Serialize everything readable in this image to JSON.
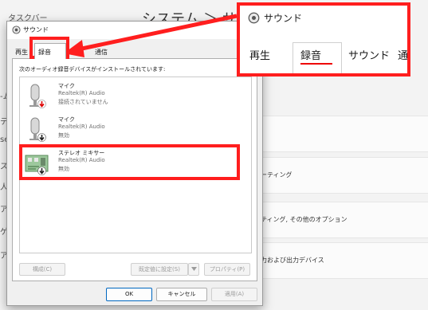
{
  "background": {
    "app_name": "タスクバー",
    "title": "システム ＞ サウ",
    "side_chars": [
      "-ム",
      "テ",
      "se",
      "ス",
      "人",
      "ア",
      "ゲ",
      "ア"
    ],
    "rows": [
      {
        "label": ""
      },
      {
        "label": "ーティング"
      },
      {
        "label": "ティング, その他のオプション"
      },
      {
        "label": "力および出力デバイス"
      }
    ]
  },
  "dialog": {
    "title": "サウンド",
    "tabs": [
      {
        "label": "再生",
        "active": false
      },
      {
        "label": "録音",
        "active": true
      },
      {
        "label": "通信",
        "active": false
      }
    ],
    "instruction": "次のオーディオ録音デバイスがインストールされています:",
    "devices": [
      {
        "name": "マイク",
        "driver": "Realtek(R) Audio",
        "status": "接続されていません",
        "type": "mic",
        "badge": "red"
      },
      {
        "name": "マイク",
        "driver": "Realtek(R) Audio",
        "status": "無効",
        "type": "mic",
        "badge": "dark"
      },
      {
        "name": "ステレオ ミキサー",
        "driver": "Realtek(R) Audio",
        "status": "無効",
        "type": "board",
        "badge": "dark"
      }
    ],
    "buttons": {
      "configure": "構成(C)",
      "set_default": "既定値に設定(S)",
      "properties": "プロパティ(P)",
      "ok": "OK",
      "cancel": "キャンセル",
      "apply": "適用(A)"
    }
  },
  "callout": {
    "title": "サウンド",
    "tabs": [
      {
        "label": "再生"
      },
      {
        "label": "録音"
      },
      {
        "label": "サウンド"
      },
      {
        "label": "通"
      }
    ]
  },
  "colors": {
    "annotation_red": "#ff1e1e",
    "accent_blue": "#0067c0"
  }
}
